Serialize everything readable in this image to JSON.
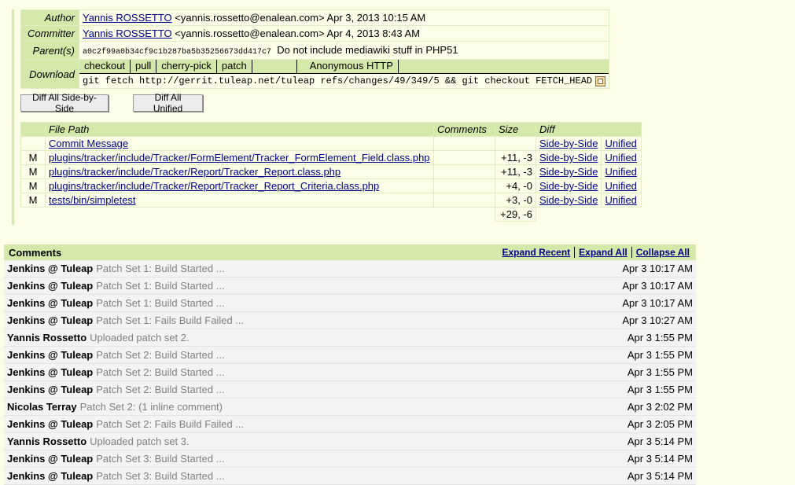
{
  "commit": {
    "author_label": "Author",
    "author_name": "Yannis ROSSETTO",
    "author_rest": "<yannis.rossetto@enalean.com> Apr 3, 2013 10:15 AM",
    "committer_label": "Committer",
    "committer_name": "Yannis ROSSETTO",
    "committer_rest": "<yannis.rossetto@enalean.com> Apr 4, 2013 8:43 AM",
    "parents_label": "Parent(s)",
    "parent_hash": "a0c2f99a0b34cf9c1b287ba5b35256673dd417c7",
    "parent_msg": "Do not include mediawiki stuff in PHP51",
    "download_label": "Download",
    "download_tabs": [
      "checkout",
      "pull",
      "cherry-pick",
      "patch"
    ],
    "download_scheme": "Anonymous HTTP",
    "download_cmd": "git fetch http://gerrit.tuleap.net/tuleap refs/changes/49/349/5 && git checkout FETCH_HEAD"
  },
  "buttons": {
    "diff_sbs": "Diff All Side-by-Side",
    "diff_unified": "Diff All Unified"
  },
  "files": {
    "headers": [
      "",
      "File Path",
      "Comments",
      "Size",
      "Diff",
      ""
    ],
    "rows": [
      {
        "mode": "",
        "path": "Commit Message",
        "comments": "",
        "size": "",
        "sbs": "Side-by-Side",
        "uni": "Unified"
      },
      {
        "mode": "M",
        "path": "plugins/tracker/include/Tracker/FormElement/Tracker_FormElement_Field.class.php",
        "comments": "",
        "size": "+11, -3",
        "sbs": "Side-by-Side",
        "uni": "Unified"
      },
      {
        "mode": "M",
        "path": "plugins/tracker/include/Tracker/Report/Tracker_Report.class.php",
        "comments": "",
        "size": "+11, -3",
        "sbs": "Side-by-Side",
        "uni": "Unified"
      },
      {
        "mode": "M",
        "path": "plugins/tracker/include/Tracker/Report/Tracker_Report_Criteria.class.php",
        "comments": "",
        "size": "+4, -0",
        "sbs": "Side-by-Side",
        "uni": "Unified"
      },
      {
        "mode": "M",
        "path": "tests/bin/simpletest",
        "comments": "",
        "size": "+3, -0",
        "sbs": "Side-by-Side",
        "uni": "Unified"
      }
    ],
    "total": "+29, -6"
  },
  "comments": {
    "title": "Comments",
    "expand_recent": "Expand Recent",
    "expand_all": "Expand All",
    "collapse_all": "Collapse All",
    "items": [
      {
        "author": "Jenkins @ Tuleap",
        "summary": "Patch Set 1: Build Started ...",
        "date": "Apr 3 10:17 AM"
      },
      {
        "author": "Jenkins @ Tuleap",
        "summary": "Patch Set 1: Build Started ...",
        "date": "Apr 3 10:17 AM"
      },
      {
        "author": "Jenkins @ Tuleap",
        "summary": "Patch Set 1: Build Started ...",
        "date": "Apr 3 10:17 AM"
      },
      {
        "author": "Jenkins @ Tuleap",
        "summary": "Patch Set 1: Fails Build Failed ...",
        "date": "Apr 3 10:27 AM"
      },
      {
        "author": "Yannis Rossetto",
        "summary": "Uploaded patch set 2.",
        "date": "Apr 3 1:55 PM"
      },
      {
        "author": "Jenkins @ Tuleap",
        "summary": "Patch Set 2: Build Started ...",
        "date": "Apr 3 1:55 PM"
      },
      {
        "author": "Jenkins @ Tuleap",
        "summary": "Patch Set 2: Build Started ...",
        "date": "Apr 3 1:55 PM"
      },
      {
        "author": "Jenkins @ Tuleap",
        "summary": "Patch Set 2: Build Started ...",
        "date": "Apr 3 1:55 PM"
      },
      {
        "author": "Nicolas Terray",
        "summary": "Patch Set 2: (1 inline comment)",
        "date": "Apr 3 2:02 PM"
      },
      {
        "author": "Jenkins @ Tuleap",
        "summary": "Patch Set 2: Fails Build Failed ...",
        "date": "Apr 3 2:05 PM"
      },
      {
        "author": "Yannis Rossetto",
        "summary": "Uploaded patch set 3.",
        "date": "Apr 3 5:14 PM"
      },
      {
        "author": "Jenkins @ Tuleap",
        "summary": "Patch Set 3: Build Started ...",
        "date": "Apr 3 5:14 PM"
      },
      {
        "author": "Jenkins @ Tuleap",
        "summary": "Patch Set 3: Build Started ...",
        "date": "Apr 3 5:14 PM"
      }
    ]
  }
}
